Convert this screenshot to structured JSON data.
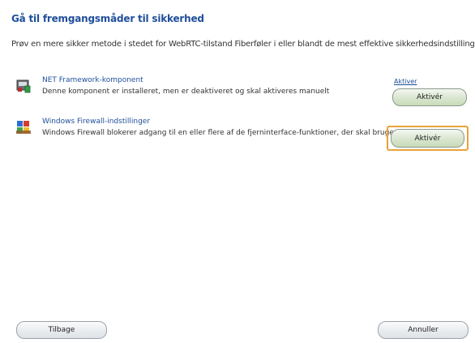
{
  "page": {
    "title": "Gå til fremgangsmåder til sikkerhed",
    "description": "Prøv en mere sikker metode i stedet for WebRTC-tilstand Fiberføler i eller blandt de mest effektive sikkerhedsindstillinger."
  },
  "items": [
    {
      "title": "NET Framework-komponent",
      "description": "Denne komponent er installeret, men er deaktiveret og skal aktiveres manuelt",
      "link": "Aktiver",
      "button": "Aktivér",
      "icon": "component-icon"
    },
    {
      "title": "Windows Firewall-indstillinger",
      "description": "Windows Firewall blokerer adgang til en eller flere af de fjerninterface-funktioner, der skal bruges",
      "button": "Aktivér",
      "icon": "firewall-icon"
    }
  ],
  "footer": {
    "back_label": "Tilbage",
    "next_label": "Annuller"
  },
  "colors": {
    "title": "#1f4e9a",
    "focus": "#e8a23a",
    "button_green": "#c8dbb9"
  }
}
